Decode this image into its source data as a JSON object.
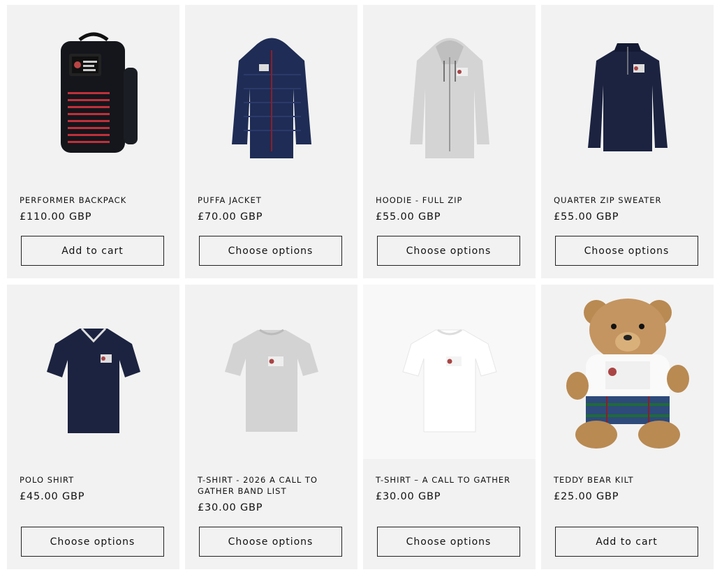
{
  "products": [
    {
      "title": "PERFORMER BACKPACK",
      "price": "£110.00 GBP",
      "button": "Add to cart",
      "image": "backpack-image"
    },
    {
      "title": "PUFFA JACKET",
      "price": "£70.00 GBP",
      "button": "Choose options",
      "image": "puffa-jacket-image"
    },
    {
      "title": "HOODIE - FULL ZIP",
      "price": "£55.00 GBP",
      "button": "Choose options",
      "image": "hoodie-image"
    },
    {
      "title": "QUARTER ZIP SWEATER",
      "price": "£55.00 GBP",
      "button": "Choose options",
      "image": "quarter-zip-image"
    },
    {
      "title": "POLO SHIRT",
      "price": "£45.00 GBP",
      "button": "Choose options",
      "image": "polo-shirt-image"
    },
    {
      "title": "T-SHIRT - 2026 A CALL TO GATHER BAND LIST",
      "price": "£30.00 GBP",
      "button": "Choose options",
      "image": "grey-tshirt-image"
    },
    {
      "title": "T-SHIRT – A CALL TO GATHER",
      "price": "£30.00 GBP",
      "button": "Choose options",
      "image": "white-tshirt-image"
    },
    {
      "title": "TEDDY BEAR KILT",
      "price": "£25.00 GBP",
      "button": "Add to cart",
      "image": "teddy-bear-image"
    }
  ],
  "colors": {
    "card_bg": "#f2f2f2",
    "navy": "#1c2340",
    "grey": "#d6d6d6",
    "white": "#fafafa",
    "bear": "#b98a52",
    "kilt": "#2d4a7a"
  }
}
